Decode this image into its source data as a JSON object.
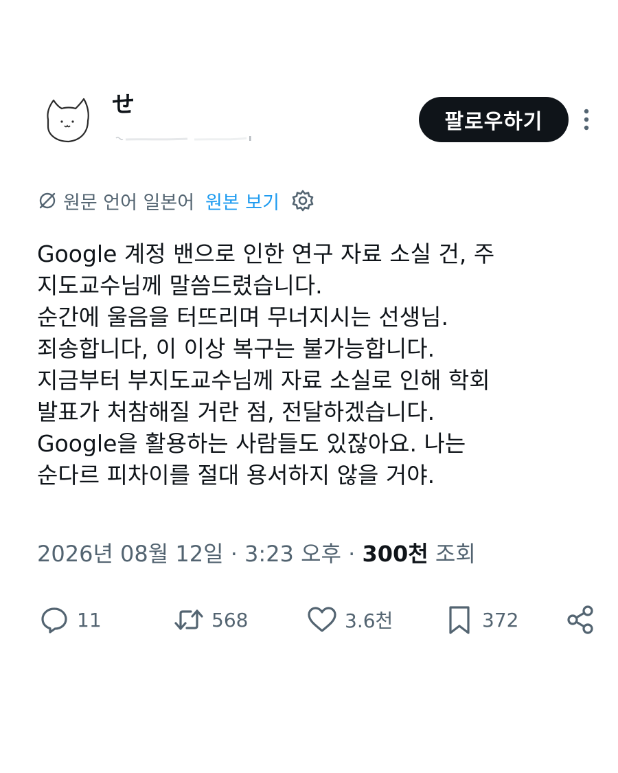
{
  "author": {
    "display_name": "せ",
    "handle": "",
    "avatar_icon": "cat-avatar-icon"
  },
  "header": {
    "follow_label": "팔로우하기",
    "more_icon": "more-options-icon"
  },
  "translation": {
    "icon": "translate-icon",
    "source_language_label": "원문 언어 일본어",
    "show_original_label": "원본 보기",
    "settings_icon": "gear-icon"
  },
  "tweet": {
    "lines": [
      "Google 계정 밴으로 인한 연구 자료 소실 건, 주",
      "지도교수님께 말씀드렸습니다.",
      "순간에 울음을 터뜨리며 무너지시는 선생님.",
      "죄송합니다, 이 이상 복구는 불가능합니다.",
      "지금부터 부지도교수님께 자료 소실로 인해 학회",
      "발표가 처참해질 거란 점, 전달하겠습니다.",
      "Google을 활용하는 사람들도 있잖아요. 나는",
      "순다르 피차이를 절대 용서하지 않을 거야."
    ]
  },
  "meta": {
    "timestamp": "2026년 08월 12일 · 3:23 오후",
    "separator": " · ",
    "views_count": "300천",
    "views_label": "조회"
  },
  "actions": {
    "replies": "11",
    "reposts": "568",
    "likes": "3.6천",
    "bookmarks": "372"
  },
  "colors": {
    "text": "#0f1419",
    "secondary": "#536471",
    "accent": "#1d9bf0",
    "button_bg": "#0f1419"
  }
}
